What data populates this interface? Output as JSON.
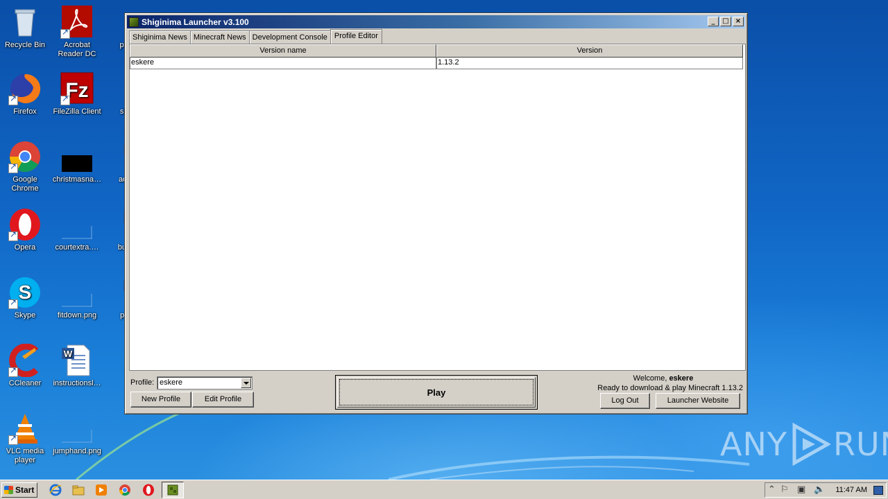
{
  "desktop": {
    "icons": [
      {
        "label": "Recycle Bin",
        "icon": "recycle-bin-icon"
      },
      {
        "label": "Acrobat Reader DC",
        "icon": "acrobat-icon"
      },
      {
        "label": "popul",
        "icon": "file-icon"
      },
      {
        "label": "Firefox",
        "icon": "firefox-icon"
      },
      {
        "label": "FileZilla Client",
        "icon": "filezilla-icon"
      },
      {
        "label": "situat",
        "icon": "file-icon"
      },
      {
        "label": "Google Chrome",
        "icon": "chrome-icon"
      },
      {
        "label": "christmasna…",
        "icon": "image-file-icon"
      },
      {
        "label": "admin",
        "icon": "word-document-icon"
      },
      {
        "label": "Opera",
        "icon": "opera-icon"
      },
      {
        "label": "courtextra.…",
        "icon": "blank-file-icon"
      },
      {
        "label": "busine",
        "icon": "word-document-icon"
      },
      {
        "label": "Skype",
        "icon": "skype-icon"
      },
      {
        "label": "fitdown.png",
        "icon": "blank-file-icon"
      },
      {
        "label": "progr",
        "icon": "word-document-icon"
      },
      {
        "label": "CCleaner",
        "icon": "ccleaner-icon"
      },
      {
        "label": "instructionsl…",
        "icon": "word-document-icon"
      },
      {
        "label": "VLC media player",
        "icon": "vlc-icon"
      },
      {
        "label": "jumphand.png",
        "icon": "blank-file-icon"
      }
    ]
  },
  "window": {
    "title": "Shiginima Launcher v3.100",
    "tabs": [
      {
        "label": "Shiginima News"
      },
      {
        "label": "Minecraft News"
      },
      {
        "label": "Development Console"
      },
      {
        "label": "Profile Editor"
      }
    ],
    "active_tab": "Profile Editor",
    "table": {
      "columns": [
        "Version name",
        "Version"
      ],
      "rows": [
        [
          "eskere",
          "1.13.2"
        ]
      ]
    },
    "profile_label": "Profile:",
    "profile_value": "eskere",
    "new_profile_label": "New Profile",
    "edit_profile_label": "Edit Profile",
    "play_label": "Play",
    "welcome_prefix": "Welcome,",
    "welcome_user": "eskere",
    "status": "Ready to download & play Minecraft 1.13.2",
    "logout_label": "Log Out",
    "website_label": "Launcher Website"
  },
  "taskbar": {
    "start_label": "Start",
    "clock": "11:47 AM"
  },
  "watermark": {
    "left": "ANY",
    "right": "RUN"
  }
}
